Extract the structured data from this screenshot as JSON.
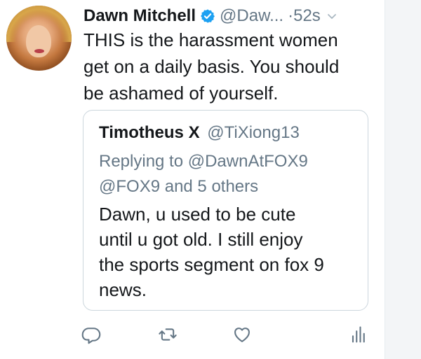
{
  "tweet": {
    "display_name": "Dawn Mitchell",
    "handle": "@Daw...",
    "separator": "·",
    "time": "52s",
    "text_lines": [
      "THIS is the harassment women",
      "get on a daily basis. You should",
      "be ashamed of yourself."
    ]
  },
  "quoted_tweet": {
    "display_name": "Timotheus X",
    "handle": "@TiXiong13",
    "reply_lines": [
      "Replying to @DawnAtFOX9",
      "@FOX9 and 5 others"
    ],
    "text_lines": [
      "Dawn, u used to be cute",
      "until u got old. I still enjoy",
      "the sports segment on fox 9",
      "news."
    ]
  },
  "icons": {
    "verified": "verified-badge-icon",
    "menu": "chevron-down-icon",
    "reply": "reply-icon",
    "retweet": "retweet-icon",
    "like": "heart-icon",
    "analytics": "analytics-icon"
  },
  "colors": {
    "twitter_blue": "#1da1f2",
    "secondary_text": "#657786",
    "primary_text": "#14171a",
    "border": "#ccd6dd"
  }
}
